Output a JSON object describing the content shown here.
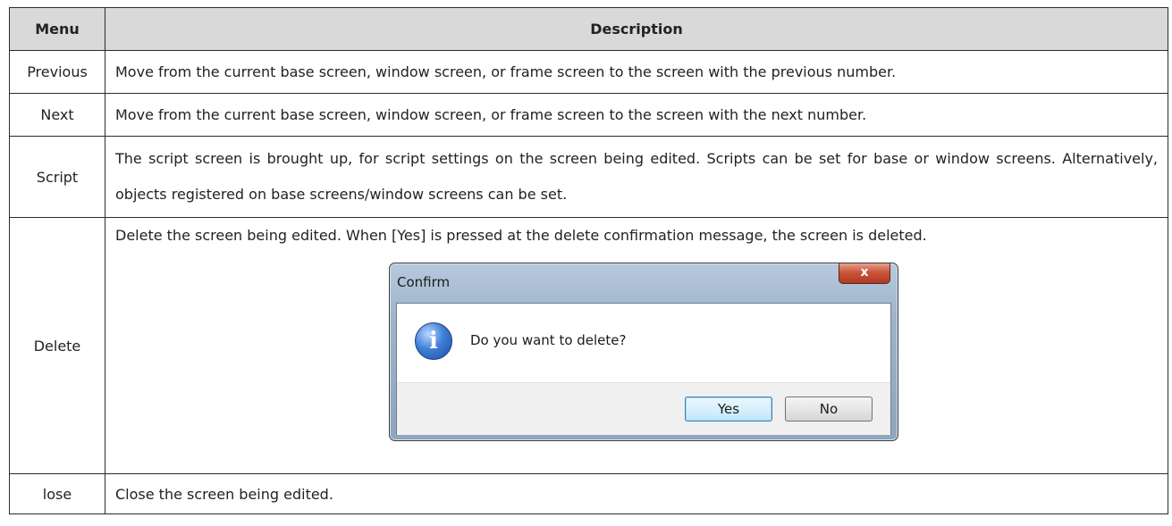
{
  "table": {
    "headers": {
      "menu": "Menu",
      "description": "Description"
    },
    "rows": [
      {
        "menu": "Previous",
        "description": "Move from the current base screen, window screen, or frame screen to the screen with the previous number."
      },
      {
        "menu": "Next",
        "description": "Move from the current base screen, window screen, or frame screen to the screen with the next number."
      },
      {
        "menu": "Script",
        "description": "The script screen is brought up, for script settings on the screen being edited. Scripts can be set for base or window screens. Alternatively, objects registered on base screens/window screens can be set."
      },
      {
        "menu": "Delete",
        "description": "Delete the screen being edited. When [Yes] is pressed at the delete confirmation message, the screen is deleted."
      },
      {
        "menu": "lose",
        "description": "Close the screen being edited."
      }
    ]
  },
  "dialog": {
    "title": "Confirm",
    "close_label": "x",
    "message": "Do you want to delete?",
    "icon": "info-icon",
    "yes_label": "Yes",
    "no_label": "No"
  }
}
